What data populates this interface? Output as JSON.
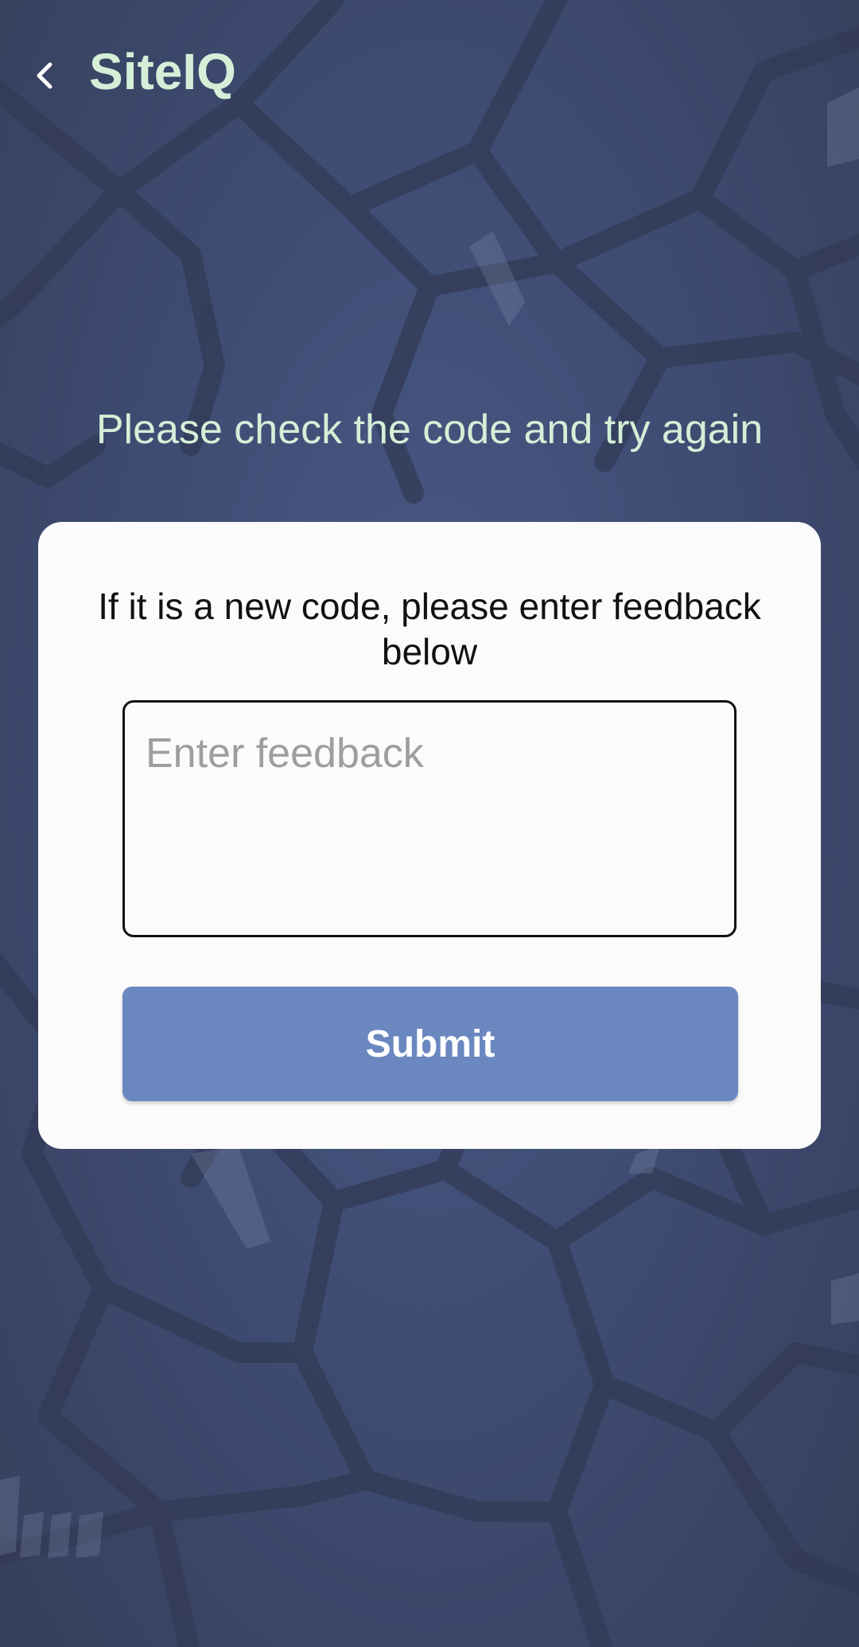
{
  "app_bar": {
    "back_icon": "chevron-left-icon",
    "title": "SiteIQ"
  },
  "message": "Please check the code and try again",
  "card": {
    "instruction": "If it is a new code, please enter feedback below",
    "feedback_input": {
      "value": "",
      "placeholder": "Enter feedback"
    },
    "submit_label": "Submit"
  },
  "colors": {
    "background": "#414f78",
    "title": "#d4efd7",
    "card": "#fbfbfc",
    "button": "#6b87c0",
    "button_text": "#ffffff"
  }
}
